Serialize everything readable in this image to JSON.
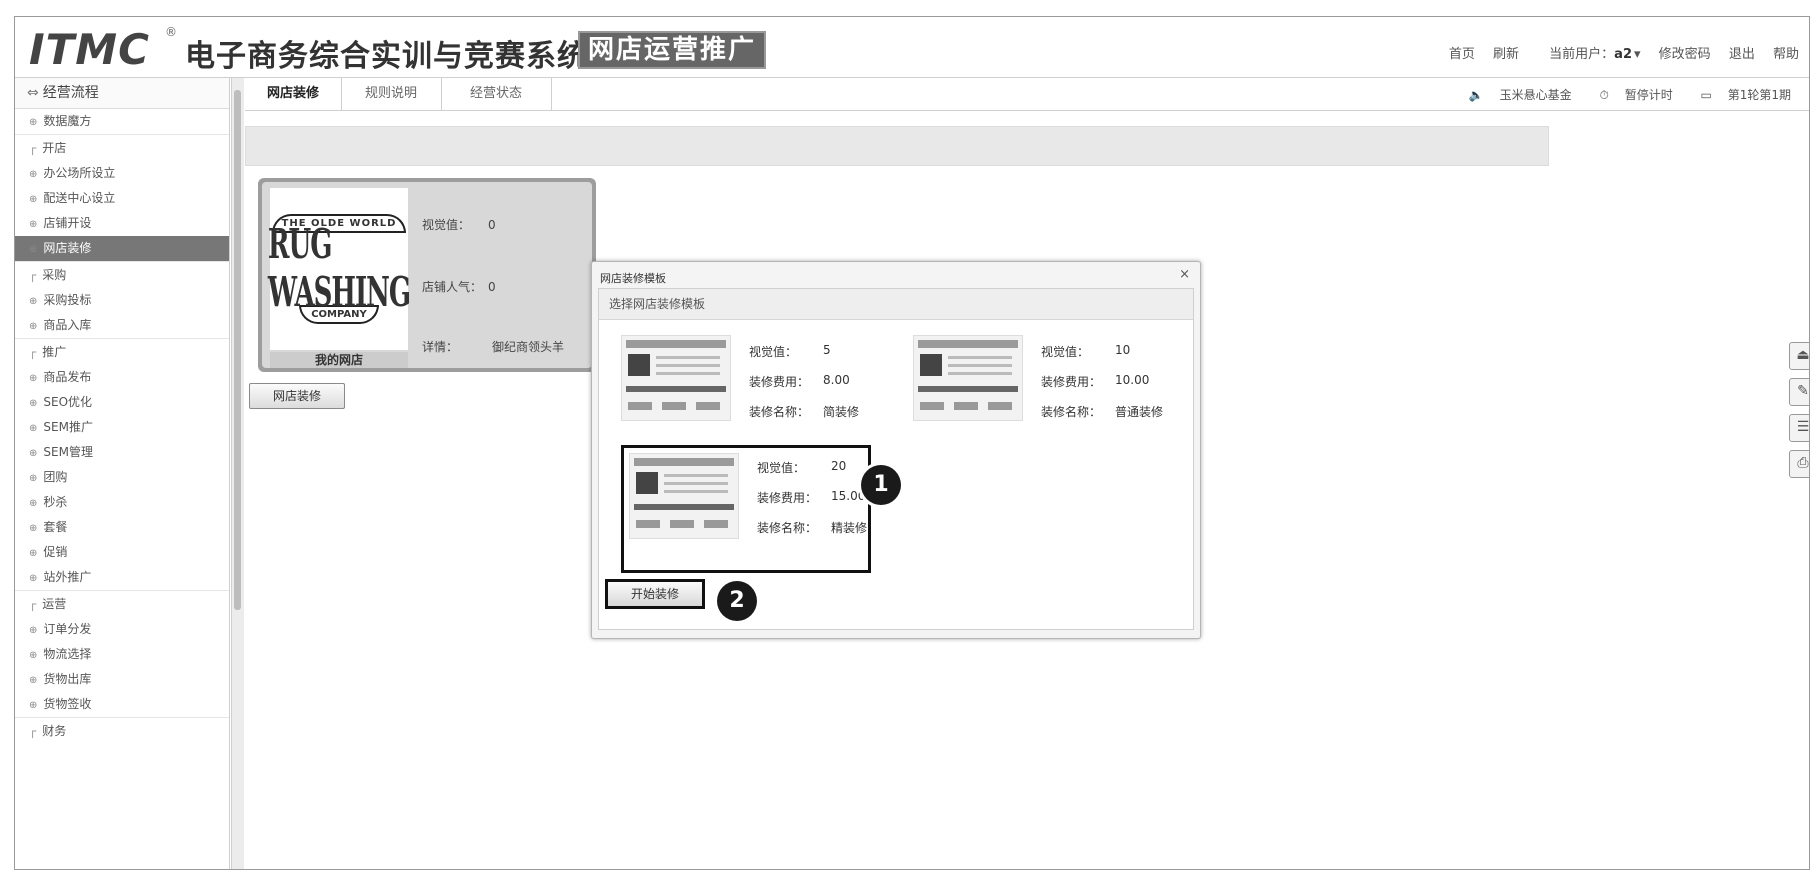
{
  "header": {
    "brand": "ITMC",
    "reg_mark": "®",
    "system_title": "电子商务综合实训与竞赛系统",
    "subsystem_badge": "网店运营推广",
    "nav": {
      "home": "首页",
      "refresh": "刷新",
      "current_user_label": "当前用户：",
      "current_user": "a2",
      "change_password": "修改密码",
      "logout": "退出",
      "help": "帮助"
    }
  },
  "sidebar": {
    "header": "经营流程",
    "items": [
      {
        "label": "数据魔方",
        "type": "item"
      },
      {
        "label": "开店",
        "type": "group"
      },
      {
        "label": "办公场所设立",
        "type": "item"
      },
      {
        "label": "配送中心设立",
        "type": "item"
      },
      {
        "label": "店铺开设",
        "type": "item"
      },
      {
        "label": "网店装修",
        "type": "item",
        "active": true
      },
      {
        "label": "采购",
        "type": "group"
      },
      {
        "label": "采购投标",
        "type": "item"
      },
      {
        "label": "商品入库",
        "type": "item"
      },
      {
        "label": "推广",
        "type": "group"
      },
      {
        "label": "商品发布",
        "type": "item"
      },
      {
        "label": "SEO优化",
        "type": "item"
      },
      {
        "label": "SEM推广",
        "type": "item"
      },
      {
        "label": "SEM管理",
        "type": "item"
      },
      {
        "label": "团购",
        "type": "item"
      },
      {
        "label": "秒杀",
        "type": "item"
      },
      {
        "label": "套餐",
        "type": "item"
      },
      {
        "label": "促销",
        "type": "item"
      },
      {
        "label": "站外推广",
        "type": "item"
      },
      {
        "label": "运营",
        "type": "group"
      },
      {
        "label": "订单分发",
        "type": "item"
      },
      {
        "label": "物流选择",
        "type": "item"
      },
      {
        "label": "货物出库",
        "type": "item"
      },
      {
        "label": "货物签收",
        "type": "item"
      },
      {
        "label": "财务",
        "type": "group"
      }
    ]
  },
  "tabs": [
    {
      "label": "网店装修",
      "active": true
    },
    {
      "label": "规则说明",
      "active": false
    },
    {
      "label": "经营状态",
      "active": false
    }
  ],
  "statusbar": {
    "fund": "玉米悬心基金",
    "timer": "暂停计时",
    "period": "第1轮第1期"
  },
  "store": {
    "logo_top": "THE OLDE WORLD",
    "logo_main": "RUG WASHING",
    "logo_bottom": "COMPANY",
    "name": "我的网店",
    "visual_label": "视觉值：",
    "visual_value": "0",
    "popularity_label": "店铺人气：",
    "popularity_value": "0",
    "detail_label": "详情：",
    "detail_value": "御纪商领头羊",
    "decorate_button": "网店装修"
  },
  "dialog": {
    "title": "网店装修模板",
    "close": "×",
    "subtitle": "选择网店装修模板",
    "visual_label": "视觉值：",
    "cost_label": "装修费用：",
    "name_label": "装修名称：",
    "templates": [
      {
        "visual": "5",
        "cost": "8.00",
        "name": "简装修"
      },
      {
        "visual": "10",
        "cost": "10.00",
        "name": "普通装修"
      },
      {
        "visual": "20",
        "cost": "15.00",
        "name": "精装修"
      }
    ],
    "start_button": "开始装修",
    "marker1": "1",
    "marker2": "2"
  },
  "right_tools": [
    "folder-icon",
    "edit-icon",
    "list-icon",
    "print-icon"
  ]
}
